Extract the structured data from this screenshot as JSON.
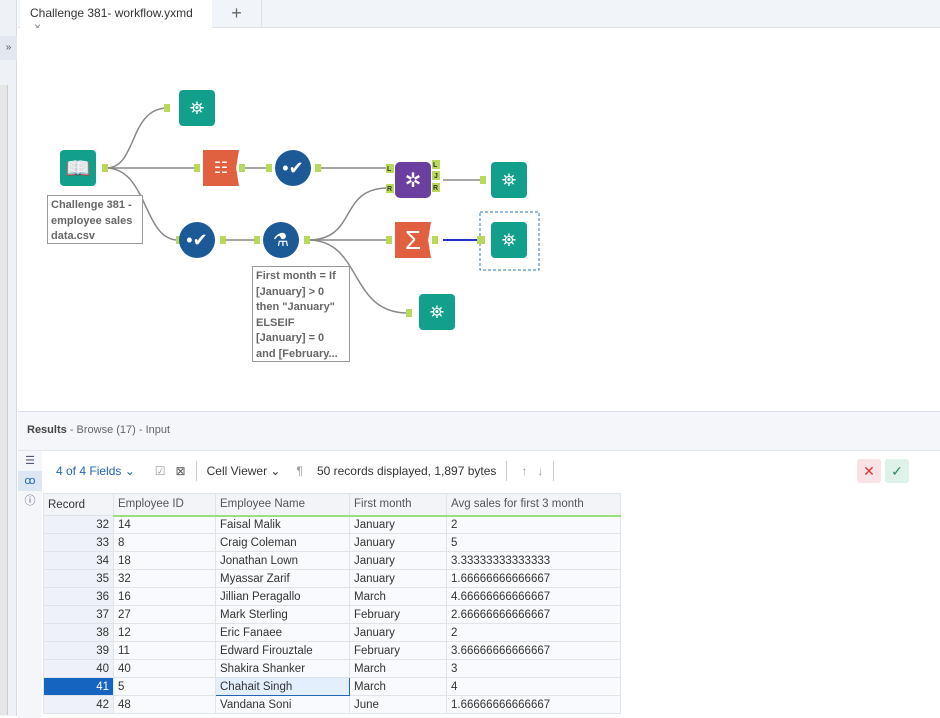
{
  "tab": {
    "title": "Challenge 381- workflow.yxmd",
    "close": "×",
    "add": "+"
  },
  "side_glyph": "»",
  "workflow": {
    "annotations": [
      "Challenge 381 - employee sales data.csv",
      "First month = If [January] > 0 then \"January\" ELSEIF [January] = 0 and [February..."
    ],
    "join_anchors": {
      "l_in": "L",
      "r_in": "R",
      "l_out": "L",
      "j_out": "J",
      "r_out": "R"
    },
    "colors": {
      "browse": "#12a08c",
      "cleanse": "#1b5a96",
      "select": "#e0603f",
      "join": "#6b3fa0",
      "summarize": "#e0603f",
      "anchor": "#b8d95a",
      "selected_wire": "#2233cc"
    }
  },
  "results": {
    "title": "Results",
    "subtitle": " - Browse (17) - Input",
    "fields_label": "4 of 4 Fields",
    "cell_viewer_label": "Cell Viewer",
    "pilcrow": "¶",
    "status": "50 records displayed, 1,897 bytes",
    "up": "↑",
    "down": "↓",
    "cancel": "✕",
    "accept": "✓",
    "columns": [
      "Record",
      "Employee ID",
      "Employee Name",
      "First month",
      "Avg sales for first 3 month"
    ],
    "rows": [
      [
        "32",
        "14",
        "Faisal Malik",
        "January",
        "2"
      ],
      [
        "33",
        "8",
        "Craig Coleman",
        "January",
        "5"
      ],
      [
        "34",
        "18",
        "Jonathan Lown",
        "January",
        "3.33333333333333"
      ],
      [
        "35",
        "32",
        "Myassar Zarif",
        "January",
        "1.66666666666667"
      ],
      [
        "36",
        "16",
        "Jillian Peragallo",
        "March",
        "4.66666666666667"
      ],
      [
        "37",
        "27",
        "Mark Sterling",
        "February",
        "2.66666666666667"
      ],
      [
        "38",
        "12",
        "Eric Fanaee",
        "January",
        "2"
      ],
      [
        "39",
        "11",
        "Edward Firouztale",
        "February",
        "3.66666666666667"
      ],
      [
        "40",
        "40",
        "Shakira Shanker",
        "March",
        "3"
      ],
      [
        "41",
        "5",
        "Chahait Singh",
        "March",
        "4"
      ],
      [
        "42",
        "48",
        "Vandana Soni",
        "June",
        "1.66666666666667"
      ]
    ],
    "selected_record": "41"
  }
}
